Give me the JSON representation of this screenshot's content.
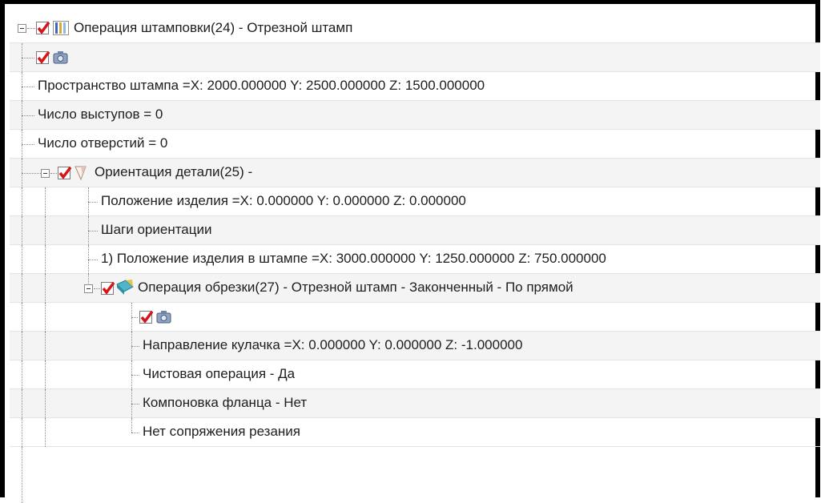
{
  "tree": {
    "rows": [
      {
        "label": "Операция штамповки(24) - Отрезной штамп",
        "checked": true,
        "icon": "stamp-operation-icon"
      },
      {
        "label": "",
        "checked": true,
        "icon": "camera-icon"
      },
      {
        "label": "Пространство штампа =X: 2000.000000 Y: 2500.000000 Z: 1500.000000"
      },
      {
        "label": "Число выступов = 0"
      },
      {
        "label": "Число отверстий = 0"
      },
      {
        "label": "Ориентация детали(25) -",
        "checked": true,
        "icon": "part-orientation-icon"
      },
      {
        "label": "Положение изделия =X: 0.000000 Y: 0.000000 Z: 0.000000"
      },
      {
        "label": "Шаги ориентации"
      },
      {
        "label": "1) Положение изделия в штампе =X: 3000.000000 Y: 1250.000000 Z: 750.000000"
      },
      {
        "label": "Операция обрезки(27) - Отрезной штамп - Законченный - По прямой",
        "checked": true,
        "icon": "trim-operation-icon"
      },
      {
        "label": "",
        "checked": true,
        "icon": "camera-icon"
      },
      {
        "label": "Направление кулачка =X: 0.000000 Y: 0.000000 Z: -1.000000"
      },
      {
        "label": "Чистовая операция - Да"
      },
      {
        "label": "Компоновка фланца - Нет"
      },
      {
        "label": "Нет сопряжения резания"
      }
    ]
  },
  "colors": {
    "check": "#d8141b",
    "border": "#000000",
    "row_alt": "#f4f4f4"
  }
}
